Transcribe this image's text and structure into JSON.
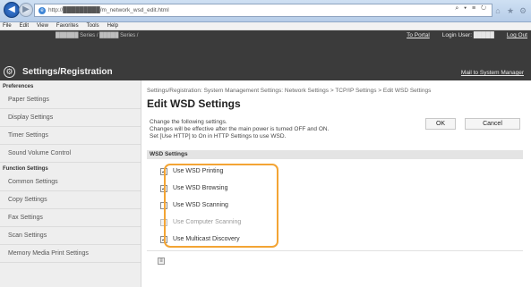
{
  "browser": {
    "url": "http://█████████/m_network_wsd_edit.html",
    "address_tools": "⌕ ▾ ≡ ↻",
    "menu": [
      "File",
      "Edit",
      "View",
      "Favorites",
      "Tools",
      "Help"
    ]
  },
  "header": {
    "device_info": "██████ Series / █████ Series /",
    "to_portal": "To Portal",
    "login_user_label": "Login User:",
    "login_user": "█████",
    "log_out": "Log Out",
    "mail_link": "Mail to System Manager",
    "title": "Settings/Registration"
  },
  "sidebar": {
    "preferences_label": "Preferences",
    "preferences": [
      "Paper Settings",
      "Display Settings",
      "Timer Settings",
      "Sound Volume Control"
    ],
    "function_label": "Function Settings",
    "functions": [
      "Common Settings",
      "Copy Settings",
      "Fax Settings",
      "Scan Settings",
      "Memory Media Print Settings"
    ]
  },
  "main": {
    "breadcrumb": "Settings/Registration: System Management Settings: Network Settings > TCP/IP Settings > Edit WSD Settings",
    "title": "Edit WSD Settings",
    "instructions": [
      "Change the following settings.",
      "Changes will be effective after the main power is turned OFF and ON.",
      "Set [Use HTTP] to On in HTTP Settings to use WSD."
    ],
    "ok_label": "OK",
    "cancel_label": "Cancel",
    "section_title": "WSD Settings",
    "options": [
      {
        "label": "Use WSD Printing",
        "checked": true,
        "enabled": true
      },
      {
        "label": "Use WSD Browsing",
        "checked": true,
        "enabled": true
      },
      {
        "label": "Use WSD Scanning",
        "checked": false,
        "enabled": true
      },
      {
        "label": "Use Computer Scanning",
        "checked": false,
        "enabled": false
      },
      {
        "label": "Use Multicast Discovery",
        "checked": true,
        "enabled": true
      }
    ]
  },
  "colors": {
    "highlight": "#f3a434",
    "header_bg": "#3b3b3b"
  }
}
